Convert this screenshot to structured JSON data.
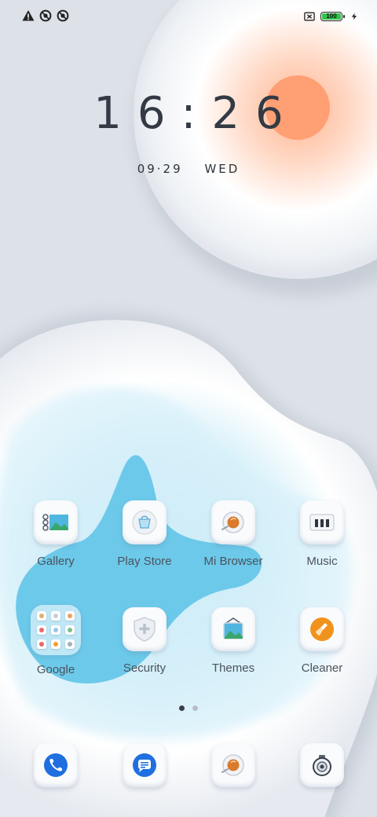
{
  "status_bar": {
    "left_icons": [
      "warning-icon",
      "data-saver-icon",
      "data-saver-icon"
    ],
    "battery_level": "100",
    "charging": true
  },
  "clock": {
    "time": "16:26"
  },
  "date": {
    "day": "09·29",
    "weekday": "WED"
  },
  "apps": [
    {
      "label": "Gallery",
      "icon": "gallery-icon"
    },
    {
      "label": "Play Store",
      "icon": "play-store-icon"
    },
    {
      "label": "Mi Browser",
      "icon": "browser-icon"
    },
    {
      "label": "Music",
      "icon": "music-icon"
    },
    {
      "label": "Google",
      "icon": "folder-icon"
    },
    {
      "label": "Security",
      "icon": "security-icon"
    },
    {
      "label": "Themes",
      "icon": "themes-icon"
    },
    {
      "label": "Cleaner",
      "icon": "cleaner-icon"
    }
  ],
  "pager": {
    "pages": 2,
    "current": 1
  },
  "dock": [
    "phone-icon",
    "messages-icon",
    "browser-icon",
    "camera-icon"
  ],
  "colors": {
    "accent_orange": "#ff9f74",
    "blob_blue": "#6cc9ea",
    "phone_blue": "#1f6fe0",
    "cleaner_orange": "#f0931d"
  }
}
